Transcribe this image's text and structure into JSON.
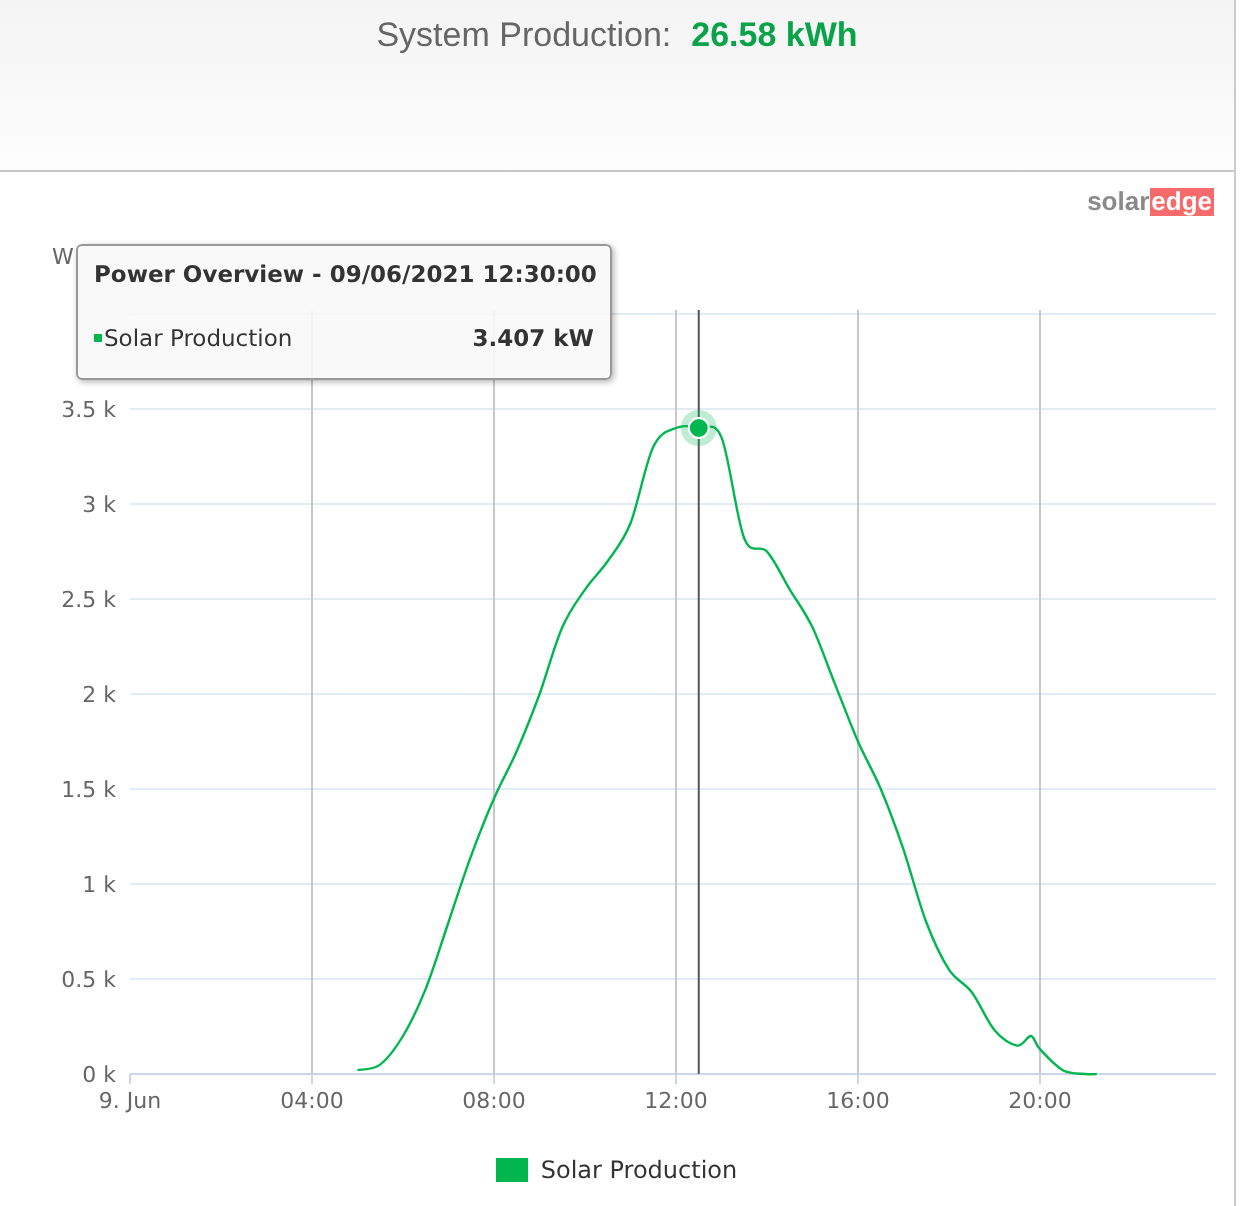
{
  "header": {
    "label": "System Production:",
    "value": "26.58 kWh"
  },
  "logo": {
    "parts": [
      "solar",
      "edge"
    ]
  },
  "chart": {
    "chart_data": {
      "type": "line",
      "ylabel": "W",
      "x": [
        5,
        5.5,
        6,
        6.5,
        7,
        7.5,
        8,
        8.5,
        9,
        9.5,
        10,
        10.5,
        11,
        11.5,
        12,
        12.5,
        13,
        13.5,
        14,
        14.5,
        15,
        15.5,
        16,
        16.5,
        17,
        17.5,
        18,
        18.5,
        19,
        19.5,
        19.8,
        20,
        20.5,
        21,
        21.25
      ],
      "series": [
        {
          "name": "Solar Production",
          "color": "#00b74f",
          "values": [
            20,
            50,
            200,
            450,
            800,
            1150,
            1450,
            1700,
            2000,
            2350,
            2550,
            2700,
            2900,
            3300,
            3400,
            3400,
            3350,
            2820,
            2750,
            2550,
            2350,
            2050,
            1750,
            1500,
            1180,
            800,
            550,
            430,
            230,
            150,
            200,
            130,
            20,
            0,
            0
          ]
        }
      ],
      "xlim": [
        0,
        24
      ],
      "ylim": [
        0,
        4000
      ],
      "xticks": [
        {
          "value": 0,
          "label": "9. Jun"
        },
        {
          "value": 4,
          "label": "04:00"
        },
        {
          "value": 8,
          "label": "08:00"
        },
        {
          "value": 12,
          "label": "12:00"
        },
        {
          "value": 16,
          "label": "16:00"
        },
        {
          "value": 20,
          "label": "20:00"
        }
      ],
      "yticks": [
        {
          "value": 0,
          "label": "0 k"
        },
        {
          "value": 500,
          "label": "0.5 k"
        },
        {
          "value": 1000,
          "label": "1 k"
        },
        {
          "value": 1500,
          "label": "1.5 k"
        },
        {
          "value": 2000,
          "label": "2 k"
        },
        {
          "value": 2500,
          "label": "2.5 k"
        },
        {
          "value": 3000,
          "label": "3 k"
        },
        {
          "value": 3500,
          "label": "3.5 k"
        }
      ],
      "grid": true,
      "ref_lines": [
        {
          "axis": "x",
          "value": 12.5,
          "color": "#555555"
        }
      ]
    },
    "tooltip": {
      "title": "Power Overview - 09/06/2021 12:30:00",
      "series": "Solar Production",
      "value": "3.407 kW"
    }
  }
}
